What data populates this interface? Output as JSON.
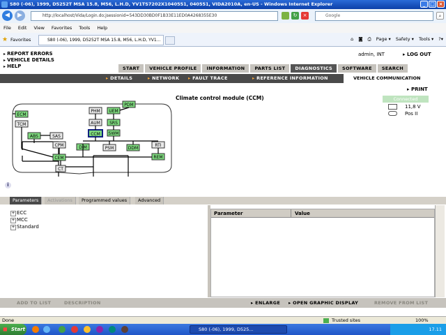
{
  "window": {
    "title": "S80 (-06), 1999, D5252T MSA 15.8, M56, L.H.D, YV1TS7202X1040551, 040551, VIDA2010A, en-US - Windows Internet Explorer"
  },
  "browser": {
    "url": "http://localhost/Vida/Login.do;jsessionid=543DD30BD0F1B33E11ED0A4268355E30",
    "search_placeholder": "Google",
    "menu": [
      "File",
      "Edit",
      "View",
      "Favorites",
      "Tools",
      "Help"
    ],
    "favorites_label": "Favorites",
    "tab_title": "S80 (-06), 1999, D5252T MSA 15.8, M56, L.H.D, YV1...",
    "tools": [
      "Page ▾",
      "Safety ▾",
      "Tools ▾",
      "?▾"
    ]
  },
  "app": {
    "toplinks": [
      "REPORT ERRORS",
      "VEHICLE DETAILS",
      "HELP"
    ],
    "user": "admin, INT",
    "logout": "LOG OUT",
    "main_tabs": [
      "START",
      "VEHICLE PROFILE",
      "INFORMATION",
      "PARTS LIST",
      "DIAGNOSTICS",
      "SOFTWARE",
      "SEARCH"
    ],
    "sub_nav": [
      "DETAILS",
      "NETWORK",
      "FAULT TRACE",
      "REFERENCE INFORMATION"
    ],
    "vehicle_communication": "VEHICLE COMMUNICATION",
    "print": "PRINT",
    "connected": "Connected",
    "voltage": "11,8 V",
    "ignition": "Pos II",
    "module_title": "Climate control module (CCM)",
    "network_modules": [
      "ECM",
      "TCM",
      "ABS",
      "SAS",
      "CPM",
      "CEM",
      "CT",
      "PHM",
      "AUM",
      "CCM",
      "UEM",
      "PDM",
      "SRS",
      "SWM",
      "DIM",
      "PSM",
      "DDM",
      "RTI",
      "REM"
    ],
    "panel_tabs": [
      "Parameters",
      "Activations",
      "Programmed values",
      "Advanced"
    ],
    "tree": [
      "ECC",
      "MCC",
      "Standard"
    ],
    "grid_headers": [
      "Parameter",
      "Value"
    ],
    "bottom": {
      "add": "ADD TO LIST",
      "desc": "DESCRIPTION",
      "enlarge": "ENLARGE",
      "open_graphic": "OPEN GRAPHIC DISPLAY",
      "remove": "REMOVE FROM LIST"
    }
  },
  "status": {
    "left": "Done",
    "trusted": "Trusted sites",
    "zoom": "100%"
  },
  "taskbar": {
    "start": "Start",
    "item": "S80 (-06), 1999, D525...",
    "clock": "17.11"
  },
  "colors": {
    "active_tab": "#555555",
    "module_green": "#7ed97e",
    "connected": "#bfe4bf"
  }
}
